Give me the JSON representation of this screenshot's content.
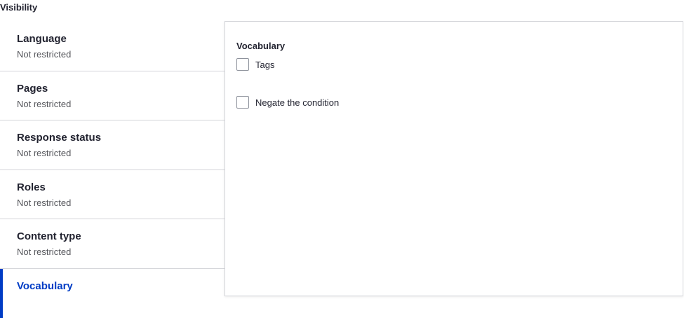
{
  "legend": "Visibility",
  "tabs": [
    {
      "title": "Language",
      "summary": "Not restricted"
    },
    {
      "title": "Pages",
      "summary": "Not restricted"
    },
    {
      "title": "Response status",
      "summary": "Not restricted"
    },
    {
      "title": "Roles",
      "summary": "Not restricted"
    },
    {
      "title": "Content type",
      "summary": "Not restricted"
    },
    {
      "title": "Vocabulary",
      "summary": ""
    }
  ],
  "selected_tab": "Vocabulary",
  "pane": {
    "heading": "Vocabulary",
    "checkboxes": [
      {
        "label": "Tags",
        "checked": false
      },
      {
        "label": "Negate the condition",
        "checked": false
      }
    ]
  },
  "colors": {
    "accent": "#003cc5",
    "border": "#d3d4d9",
    "muted_text": "#55565b"
  }
}
